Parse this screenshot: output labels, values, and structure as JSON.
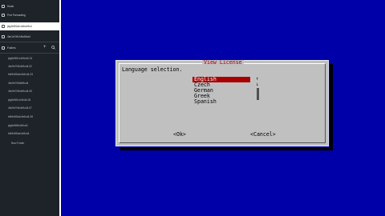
{
  "sidebar": {
    "items": [
      {
        "label": "Hosts"
      },
      {
        "label": "Port Forwarding"
      },
      {
        "label": "jeg4e8f1ab.d4bce9cd"
      },
      {
        "label": "4bc1e7d9-b9cd9cd4"
      },
      {
        "label": "Folders"
      }
    ],
    "folders": [
      "jeg6e8f4-b4e9cd4-04",
      "4bc9e7f4b4e9cd4-02",
      "bfe9e8f1ab4e9cd4-03",
      "4bc9e7f4b6b9cd4",
      "4bc9e7f4b4e9cd4-05",
      "jeg6e8f4-bc9cd4-06",
      "4bc9e7f4b4e9cd4-07",
      "bfe9e8f1ab4e9cd4-08",
      "jeg6e8f4b4e9cd4",
      "bfe9e8f1ab4e9cd4",
      "4bc9e7f4b4e9cd4"
    ],
    "new_folder": "New Folder"
  },
  "dialog": {
    "title": "View License",
    "prompt": "Language selection.",
    "languages": [
      "English",
      "Czech",
      "German",
      "Greek",
      "Spanish"
    ],
    "selected": "English",
    "scroll_up": "↑",
    "scroll_down": "↓",
    "ok": "<Ok>",
    "cancel": "<Cancel>"
  },
  "colors": {
    "terminal_bg": "#0000a8",
    "dialog_bg": "#c0c0c0",
    "highlight": "#a80000",
    "title": "#aa0000",
    "sidebar_bg": "#1e2329"
  }
}
